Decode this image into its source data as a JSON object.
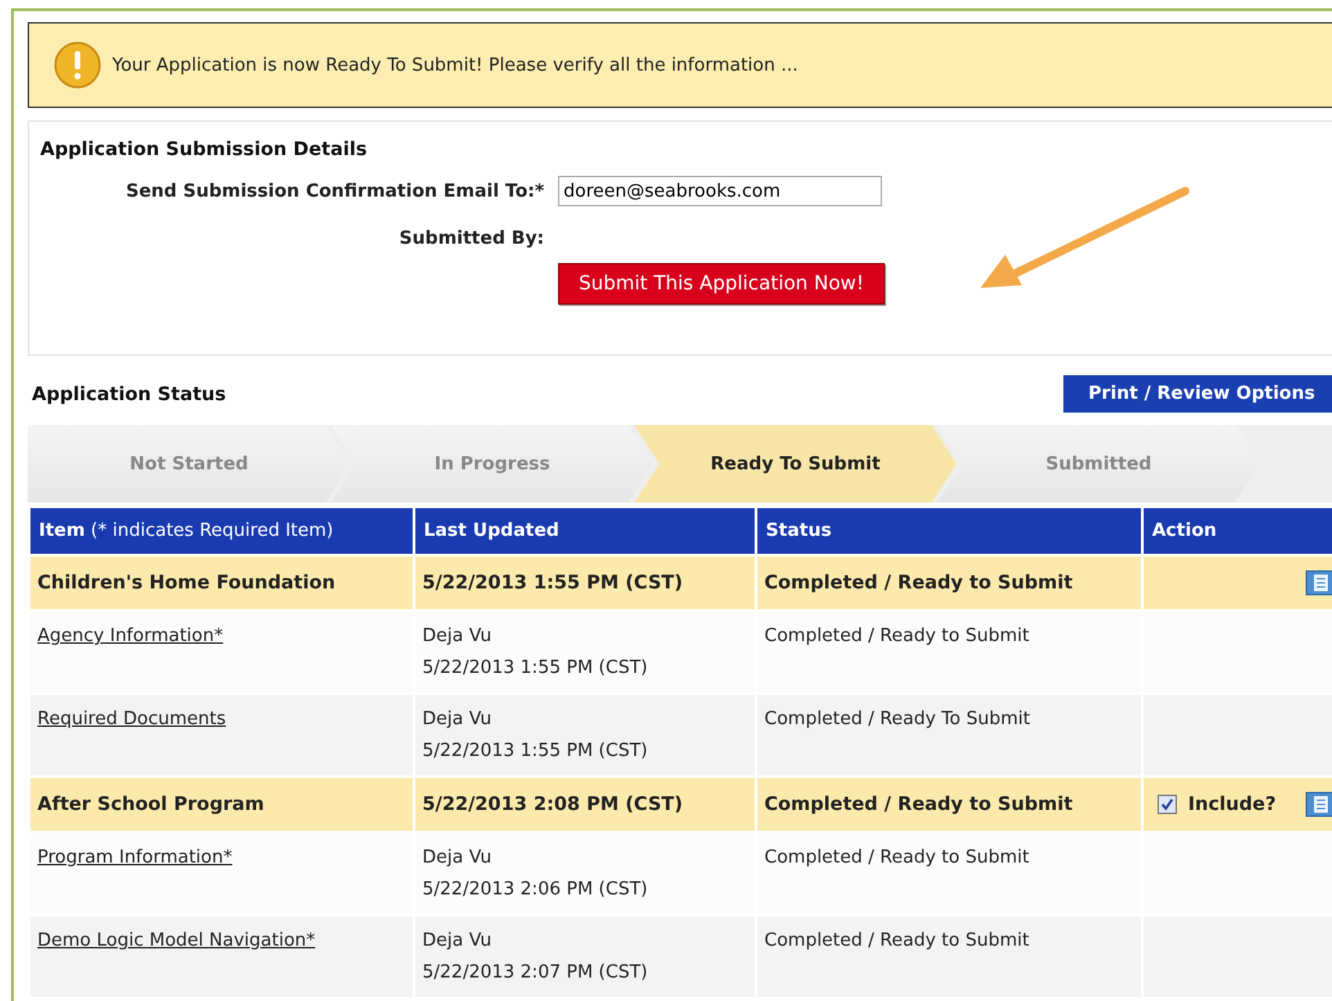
{
  "alert": {
    "message": "Your Application is now Ready To Submit! Please verify all the information ..."
  },
  "details": {
    "title": "Application Submission Details",
    "email_label": "Send Submission Confirmation Email To:*",
    "email_value": "doreen@seabrooks.com",
    "submitted_by_label": "Submitted By:",
    "submit_button": "Submit This Application Now!"
  },
  "status": {
    "title": "Application Status",
    "print_button": "Print / Review Options"
  },
  "steps": [
    {
      "label": "Not Started",
      "selected": false
    },
    {
      "label": "In Progress",
      "selected": false
    },
    {
      "label": "Ready To Submit",
      "selected": true
    },
    {
      "label": "Submitted",
      "selected": false
    }
  ],
  "table": {
    "columns": [
      "**Item** (* indicates Required Item)",
      "Last Updated",
      "Status",
      "Action"
    ],
    "groups": [
      {
        "name": "Children's Home Foundation",
        "updated": "5/22/2013 1:55 PM (CST)",
        "status": "Completed / Ready to Submit",
        "children": [
          {
            "name": "Agency Information*",
            "user": "Deja Vu",
            "updated": "5/22/2013 1:55 PM (CST)",
            "status": "Completed / Ready to Submit"
          },
          {
            "name": "Required Documents",
            "user": "Deja Vu",
            "updated": "5/22/2013 1:55 PM (CST)",
            "status": "Completed / Ready To Submit"
          }
        ]
      },
      {
        "name": "After School Program",
        "updated": "5/22/2013 2:08 PM (CST)",
        "status": "Completed / Ready to Submit",
        "include": {
          "label": "Include?",
          "checked": true
        },
        "children": [
          {
            "name": "Program Information*",
            "user": "Deja Vu",
            "updated": "5/22/2013 2:06 PM (CST)",
            "status": "Completed / Ready to Submit"
          },
          {
            "name": "Demo Logic Model Navigation*",
            "user": "Deja Vu",
            "updated": "5/22/2013 2:07 PM (CST)",
            "status": "Completed / Ready to Submit"
          }
        ]
      }
    ]
  }
}
